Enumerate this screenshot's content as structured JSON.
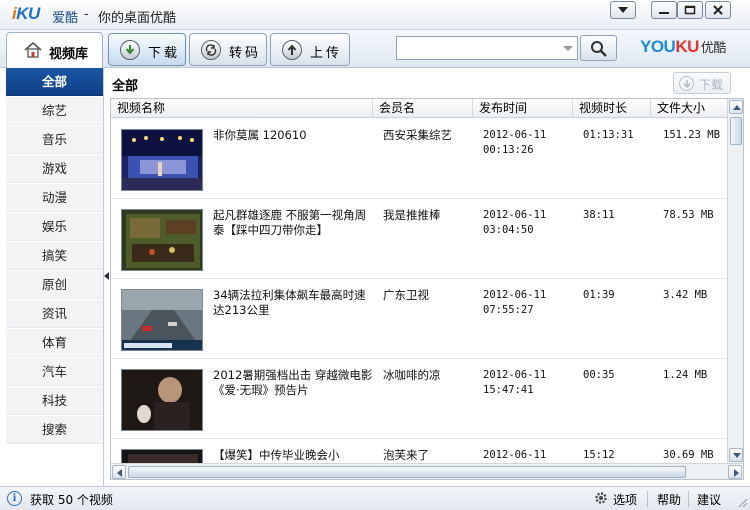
{
  "window": {
    "logo_text": "iKU",
    "app_name": "爱酷",
    "separator": "-",
    "slogan": "你的桌面优酷"
  },
  "toolbar": {
    "library_label": "视频库",
    "download_label": "下载",
    "convert_label": "转码",
    "upload_label": "上传",
    "search_value": "",
    "brand_text": "YOUKU",
    "brand_cn": "优酷"
  },
  "sidebar": {
    "items": [
      {
        "label": "全部",
        "active": true
      },
      {
        "label": "综艺"
      },
      {
        "label": "音乐"
      },
      {
        "label": "游戏"
      },
      {
        "label": "动漫"
      },
      {
        "label": "娱乐"
      },
      {
        "label": "搞笑"
      },
      {
        "label": "原创"
      },
      {
        "label": "资讯"
      },
      {
        "label": "体育"
      },
      {
        "label": "汽车"
      },
      {
        "label": "科技"
      },
      {
        "label": "搜索"
      }
    ]
  },
  "main": {
    "section_title": "全部",
    "download_button": "下载",
    "columns": [
      "视频名称",
      "会员名",
      "发布时间",
      "视频时长",
      "文件大小"
    ],
    "rows": [
      {
        "title": "非你莫属 120610",
        "member": "西安采集综艺",
        "date": "2012-06-11",
        "time": "00:13:26",
        "duration": "01:13:31",
        "size": "151.23 MB",
        "thumb_color": "#2a2f6b"
      },
      {
        "title": "起凡群雄逐鹿 不服第一视角周泰【踩中四刀带你走】",
        "member": "我是推推棒",
        "date": "2012-06-11",
        "time": "03:04:50",
        "duration": "38:11",
        "size": "78.53 MB",
        "thumb_color": "#3b4a28"
      },
      {
        "title": "34辆法拉利集体飙车最高时速达213公里",
        "member": "广东卫视",
        "date": "2012-06-11",
        "time": "07:55:27",
        "duration": "01:39",
        "size": "3.42 MB",
        "thumb_color": "#4a5660"
      },
      {
        "title": "2012暑期强档出击 穿越微电影 《爱·无瑕》预告片",
        "member": "冰咖啡的凉",
        "date": "2012-06-11",
        "time": "15:47:41",
        "duration": "00:35",
        "size": "1.24 MB",
        "thumb_color": "#241c18"
      },
      {
        "title": "【爆笑】中传毕业晚会小",
        "member": "泡芙来了",
        "date": "2012-06-11",
        "time": "",
        "duration": "15:12",
        "size": "30.69 MB",
        "thumb_color": "#1a1a1a"
      }
    ]
  },
  "status": {
    "text": "获取 50 个视频",
    "options": "选项",
    "help": "帮助",
    "feedback": "建议"
  },
  "colors": {
    "accent": "#0e3f86",
    "brand_blue": "#1a8be0",
    "brand_red": "#e8322c"
  }
}
